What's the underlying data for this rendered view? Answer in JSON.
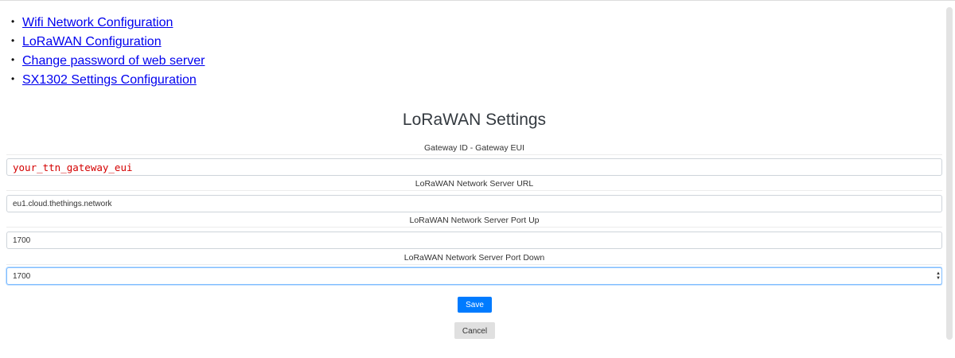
{
  "nav": {
    "items": [
      {
        "label": "Wifi Network Configuration"
      },
      {
        "label": "LoRaWAN Configuration"
      },
      {
        "label": "Change password of web server"
      },
      {
        "label": "SX1302 Settings Configuration"
      }
    ]
  },
  "page": {
    "title": "LoRaWAN Settings"
  },
  "form": {
    "gateway_id": {
      "label": "Gateway ID - Gateway EUI",
      "value": "your_ttn_gateway_eui"
    },
    "server_url": {
      "label": "LoRaWAN Network Server URL",
      "value": "eu1.cloud.thethings.network"
    },
    "port_up": {
      "label": "LoRaWAN Network Server Port Up",
      "value": "1700"
    },
    "port_down": {
      "label": "LoRaWAN Network Server Port Down",
      "value": "1700"
    },
    "save_label": "Save",
    "cancel_label": "Cancel"
  },
  "colors": {
    "link": "#0000ee",
    "primary": "#007bff",
    "placeholder_value": "#d40000",
    "cancel_bg": "#e0e0e0"
  }
}
